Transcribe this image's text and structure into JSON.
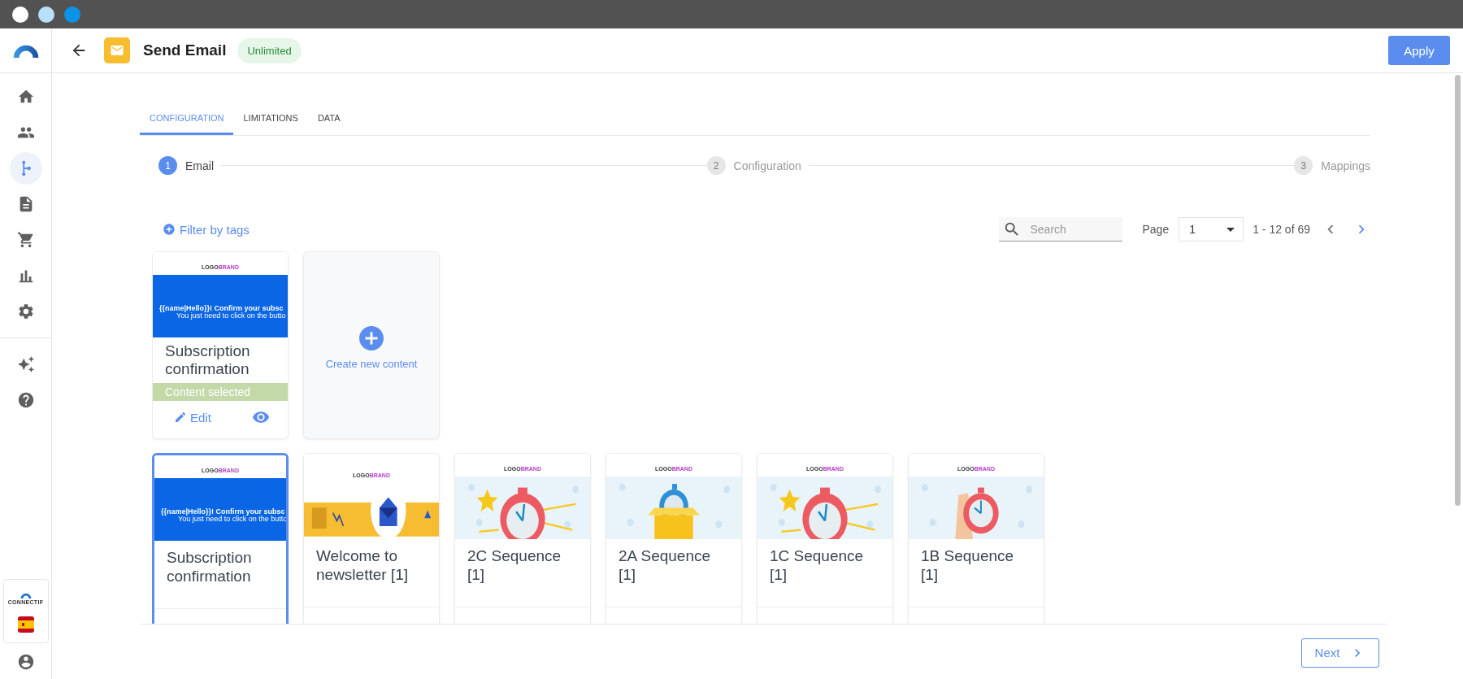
{
  "sidebar": {
    "items": [
      {
        "selected": false
      },
      {
        "selected": false
      },
      {
        "selected": true
      },
      {
        "selected": false
      },
      {
        "selected": false
      },
      {
        "selected": false
      },
      {
        "selected": false
      },
      {
        "selected": false
      },
      {
        "selected": false
      }
    ],
    "brand": "CONNECTIF"
  },
  "header": {
    "title": "Send Email",
    "badge": "Unlimited",
    "apply": "Apply"
  },
  "tabs": [
    {
      "label": "CONFIGURATION",
      "selected": true
    },
    {
      "label": "LIMITATIONS",
      "selected": false
    },
    {
      "label": "DATA",
      "selected": false
    }
  ],
  "steps": [
    {
      "number": "1",
      "label": "Email",
      "active": true
    },
    {
      "number": "2",
      "label": "Configuration",
      "active": false
    },
    {
      "number": "3",
      "label": "Mappings",
      "active": false
    }
  ],
  "filter": "Filter by tags",
  "search": {
    "placeholder": "Search"
  },
  "pagination": {
    "label": "Page",
    "page": "1",
    "range": "1 - 12 of 69"
  },
  "current_content": {
    "title": "Subscription confirmation",
    "status": "Content selected",
    "edit": "Edit",
    "preview": {
      "kind": "confirm",
      "logo": "LOGO",
      "logo_accent": "BRAND",
      "headline": "{{name|Hello}}! Confirm your subsc",
      "subline": "You just need to click on the butto"
    }
  },
  "create_card": {
    "label": "Create new content"
  },
  "templates": [
    {
      "title": "Subscription confirmation",
      "selected": true,
      "preview": {
        "kind": "confirm",
        "logo": "LOGO",
        "logo_accent": "BRAND",
        "headline": "{{name|Hello}}! Confirm your subsc",
        "subline": "You just need to click on the butto"
      }
    },
    {
      "title": "Welcome to newsletter [1]",
      "selected": false,
      "preview": {
        "kind": "welcome",
        "logo": "LOGO",
        "logo_accent": "BRAND"
      }
    },
    {
      "title": "2C Sequence [1]",
      "selected": false,
      "preview": {
        "kind": "stopwatch",
        "logo": "LOGO",
        "logo_accent": "BRAND"
      }
    },
    {
      "title": "2A Sequence [1]",
      "selected": false,
      "preview": {
        "kind": "box",
        "logo": "LOGO",
        "logo_accent": "BRAND"
      }
    },
    {
      "title": "1C Sequence [1]",
      "selected": false,
      "preview": {
        "kind": "stopwatch",
        "logo": "LOGO",
        "logo_accent": "BRAND"
      }
    },
    {
      "title": "1B Sequence [1]",
      "selected": false,
      "preview": {
        "kind": "hand",
        "logo": "LOGO",
        "logo_accent": "BRAND"
      }
    }
  ],
  "footer": {
    "next": "Next"
  }
}
